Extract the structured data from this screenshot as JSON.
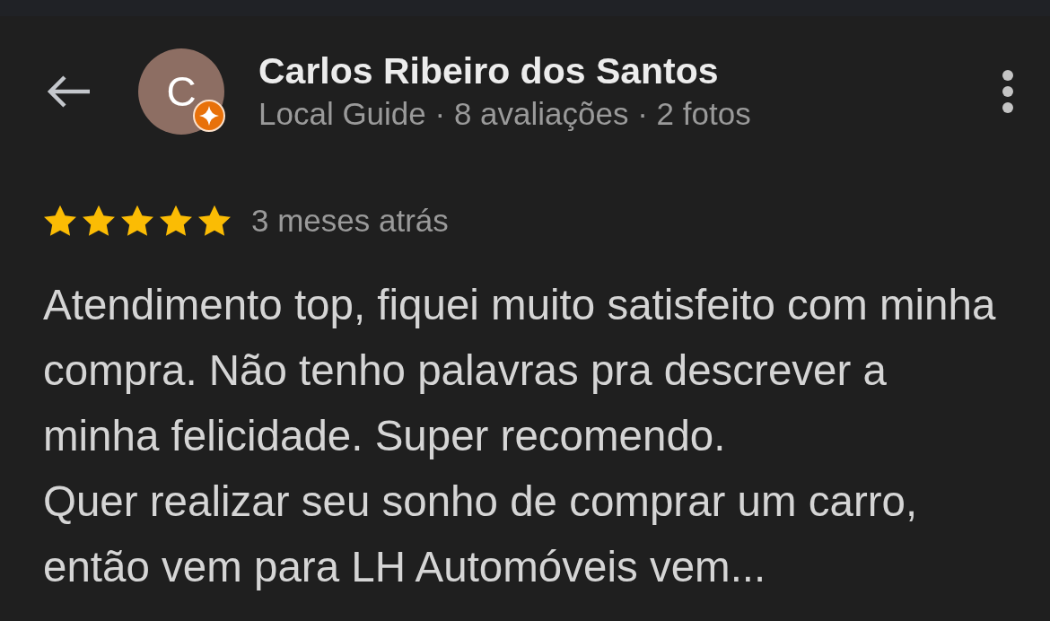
{
  "reviewer": {
    "initial": "C",
    "name": "Carlos Ribeiro dos Santos",
    "subtitle": "Local Guide · 8 avaliações · 2 fotos",
    "local_guide": true
  },
  "review": {
    "stars": 5,
    "time": "3 meses atrás",
    "paragraphs": [
      "Atendimento top, fiquei muito satisfeito com minha compra. Não tenho palavras pra descrever a minha felicidade. Super recomendo.",
      "Quer realizar seu sonho de comprar um carro, então vem para LH Automóveis vem..."
    ]
  }
}
